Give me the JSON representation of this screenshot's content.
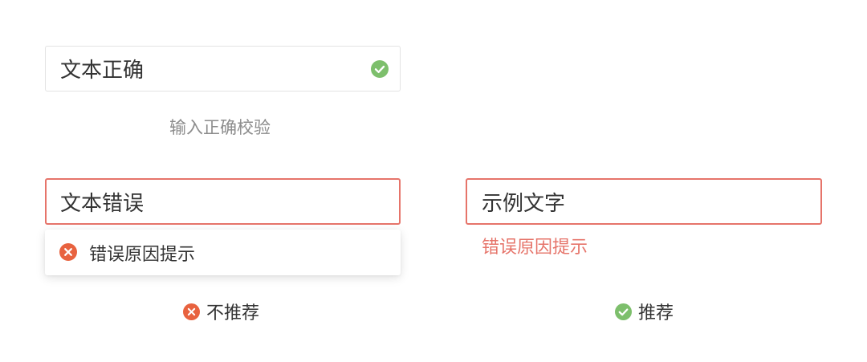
{
  "correct_example": {
    "input_value": "文本正确",
    "status_icon": "check-circle-icon",
    "caption": "输入正确校验"
  },
  "error_tooltip_example": {
    "input_value": "文本错误",
    "tooltip_icon": "error-circle-icon",
    "tooltip_message": "错误原因提示",
    "verdict_icon": "error-circle-icon",
    "verdict_label": "不推荐"
  },
  "error_inline_example": {
    "input_value": "示例文字",
    "error_message": "错误原因提示",
    "verdict_icon": "check-circle-icon",
    "verdict_label": "推荐"
  },
  "colors": {
    "success": "#7dbf6c",
    "error": "#e8623f",
    "error_border": "#e6746a",
    "neutral_border": "#e3e3e3",
    "caption": "#8c8c8c"
  }
}
